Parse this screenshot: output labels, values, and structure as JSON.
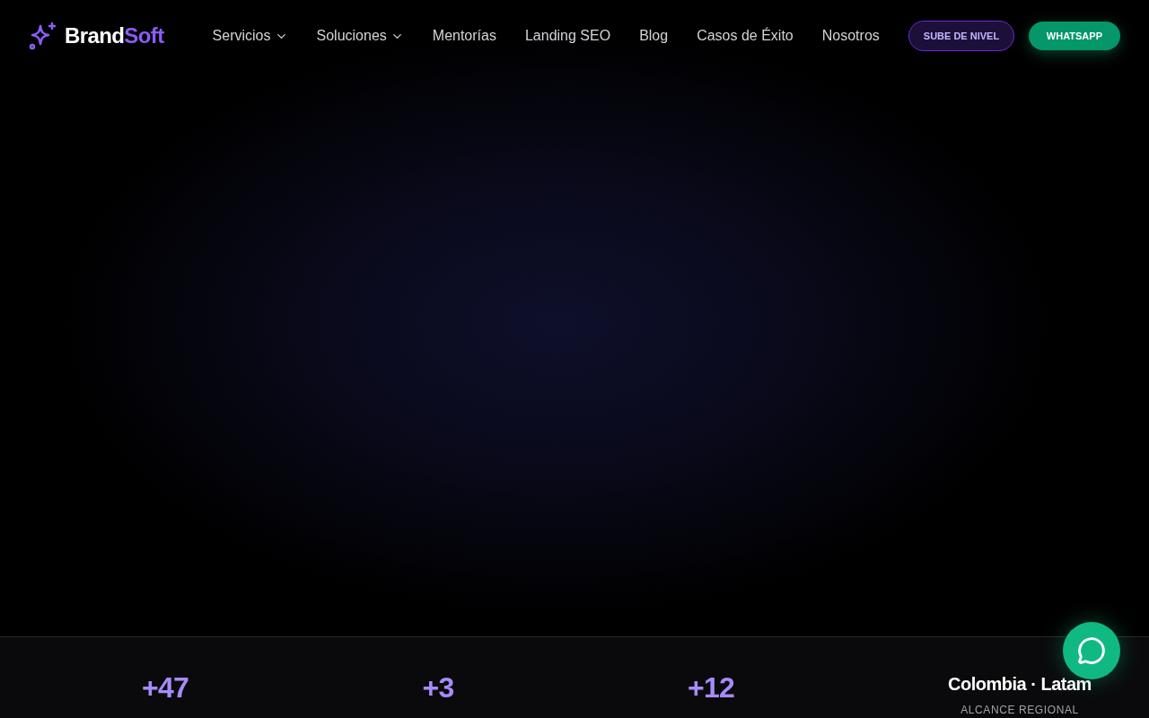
{
  "brand": {
    "part_1": "Brand",
    "part_2": "Soft"
  },
  "nav": [
    {
      "label": "Servicios",
      "dropdown": true
    },
    {
      "label": "Soluciones",
      "dropdown": true
    },
    {
      "label": "Mentorías",
      "dropdown": false
    },
    {
      "label": "Landing SEO",
      "dropdown": false
    },
    {
      "label": "Blog",
      "dropdown": false
    },
    {
      "label": "Casos de Éxito",
      "dropdown": false
    },
    {
      "label": "Nosotros",
      "dropdown": false
    }
  ],
  "buttons": {
    "upgrade": "SUBE DE NIVEL",
    "whatsapp": "WHATSAPP"
  },
  "stats": [
    {
      "value": "+47",
      "kind": "number"
    },
    {
      "value": "+3",
      "kind": "number"
    },
    {
      "value": "+12",
      "kind": "number"
    },
    {
      "value": "Colombia · Latam",
      "kind": "text",
      "caption": "ALCANCE REGIONAL"
    }
  ]
}
